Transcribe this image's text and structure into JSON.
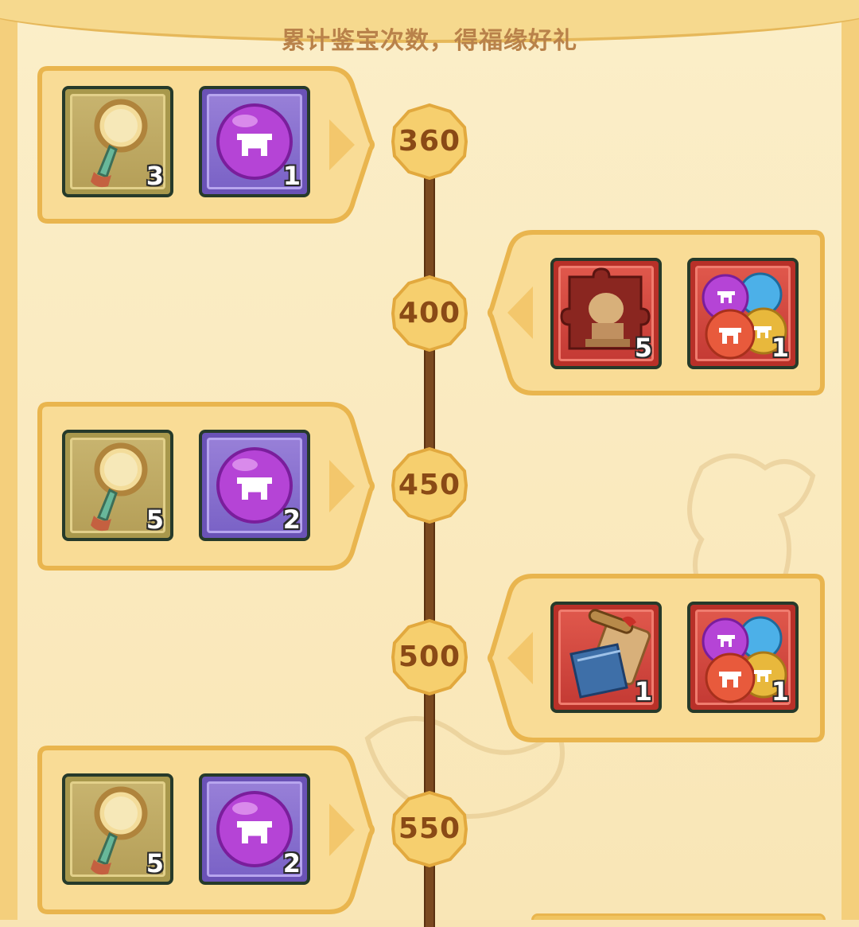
{
  "header": {
    "title": "累计鉴宝次数，得福缘好礼"
  },
  "milestones": [
    {
      "count": "360",
      "rewards": [
        {
          "icon": "magnifier-key-icon",
          "frame": "green",
          "quantity": "3"
        },
        {
          "icon": "purple-orb-icon",
          "frame": "purple",
          "quantity": "1"
        }
      ]
    },
    {
      "count": "400",
      "rewards": [
        {
          "icon": "lion-statue-puzzle-icon",
          "frame": "red",
          "quantity": "5"
        },
        {
          "icon": "multi-orb-bundle-icon",
          "frame": "red",
          "quantity": "1"
        }
      ]
    },
    {
      "count": "450",
      "rewards": [
        {
          "icon": "magnifier-key-icon",
          "frame": "green",
          "quantity": "5"
        },
        {
          "icon": "purple-orb-icon",
          "frame": "purple",
          "quantity": "2"
        }
      ]
    },
    {
      "count": "500",
      "rewards": [
        {
          "icon": "scroll-book-icon",
          "frame": "red",
          "quantity": "1"
        },
        {
          "icon": "multi-orb-bundle-icon",
          "frame": "red",
          "quantity": "1"
        }
      ]
    },
    {
      "count": "550",
      "rewards": [
        {
          "icon": "magnifier-key-icon",
          "frame": "green",
          "quantity": "5"
        },
        {
          "icon": "purple-orb-icon",
          "frame": "purple",
          "quantity": "2"
        }
      ]
    }
  ],
  "colors": {
    "background": "#f8e4b4",
    "card": "#f9dc96",
    "card_border": "#e9b54e",
    "track": "#7b4a20",
    "node_text": "#8a4a16",
    "heading": "#b9824a"
  }
}
